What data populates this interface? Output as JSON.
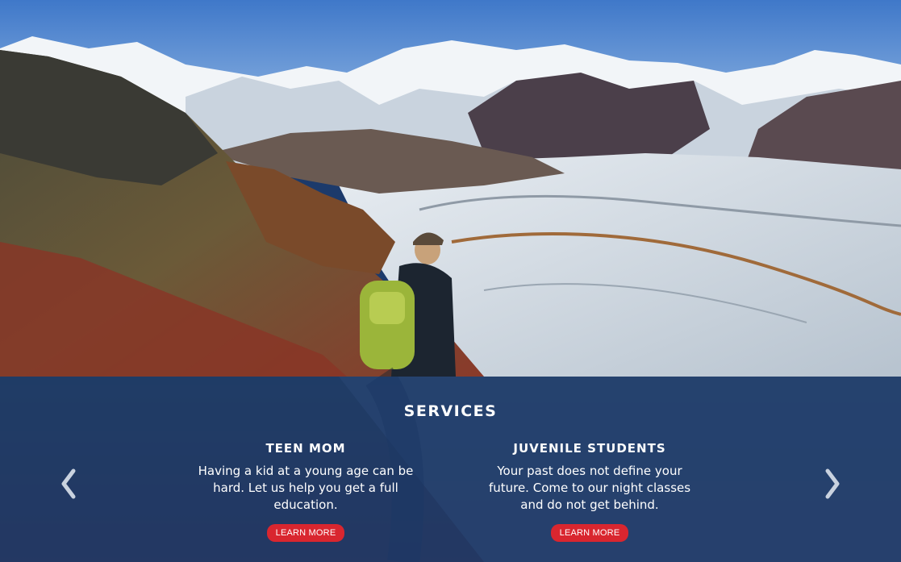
{
  "hero": {
    "image": "mountain-glacier-hiker-photo"
  },
  "services": {
    "title": "SERVICES",
    "prev_icon": "chevron-left-icon",
    "next_icon": "chevron-right-icon",
    "cards": [
      {
        "title": "TEEN MOM",
        "text": "Having a kid at a young age can be hard. Let us help you get a full education.",
        "button": "LEARN MORE"
      },
      {
        "title": "JUVENILE STUDENTS",
        "text": "Your past does not define your future. Come to our night classes and do not get behind.",
        "button": "LEARN MORE"
      }
    ]
  },
  "colors": {
    "panel": "#1b3a6e",
    "button": "#d9262f",
    "text": "#ffffff"
  }
}
